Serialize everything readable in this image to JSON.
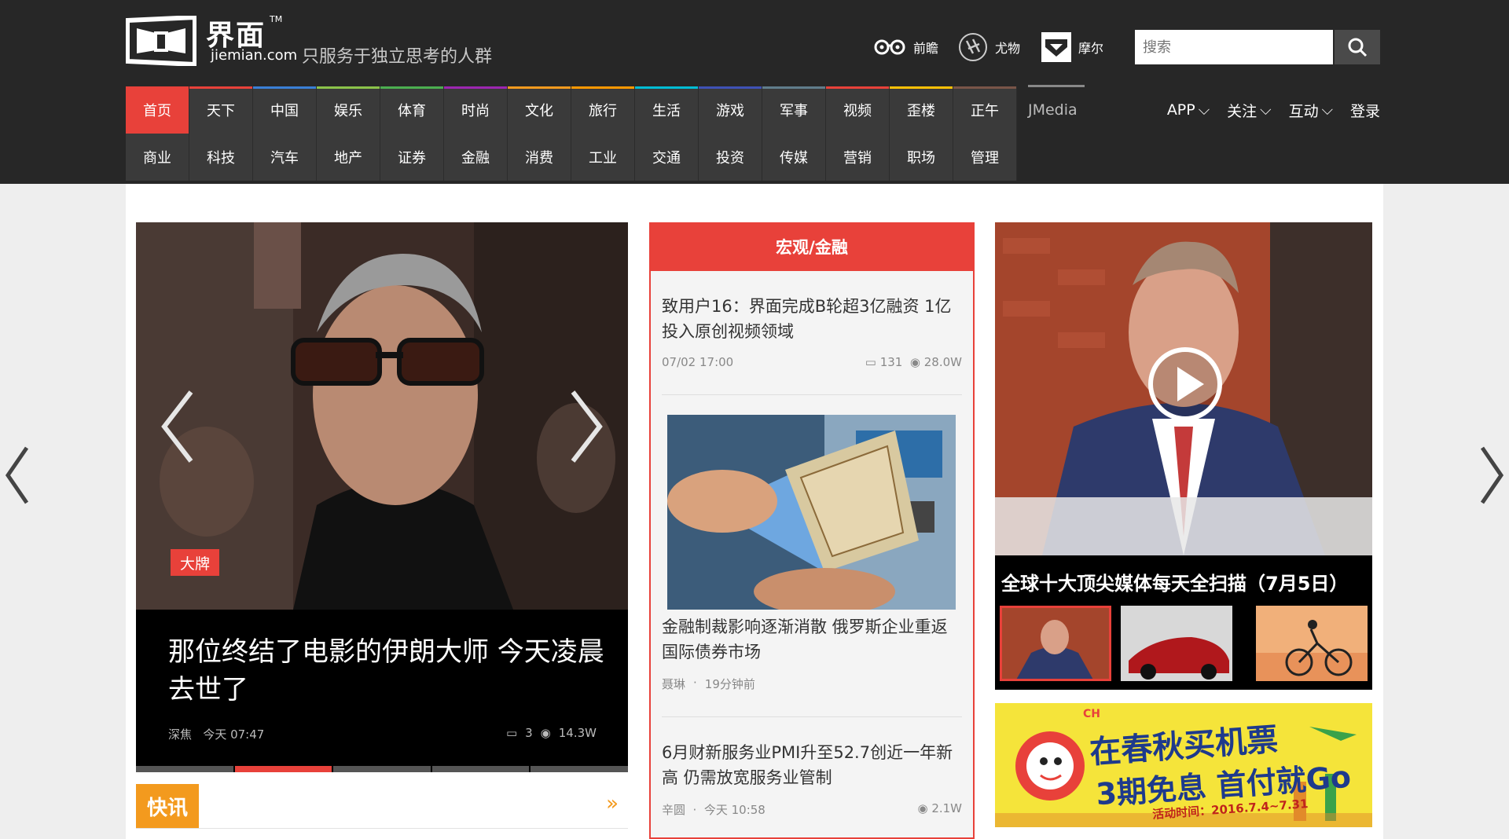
{
  "header": {
    "logo_cn": "界面",
    "logo_tm": "TM",
    "logo_en": "jiemian.com",
    "slogan": "只服务于独立思考的人群",
    "brands": [
      {
        "label": "前瞻",
        "icon": "glasses-icon"
      },
      {
        "label": "尤物",
        "icon": "youwu-seal-icon"
      },
      {
        "label": "摩尔",
        "icon": "moer-icon"
      }
    ],
    "search_placeholder": "搜索"
  },
  "nav": {
    "row1": [
      {
        "label": "首页",
        "color": "#e8413a"
      },
      {
        "label": "天下",
        "color": "#e8413a"
      },
      {
        "label": "中国",
        "color": "#3a7fd5"
      },
      {
        "label": "娱乐",
        "color": "#8bc34a"
      },
      {
        "label": "体育",
        "color": "#4caf50"
      },
      {
        "label": "时尚",
        "color": "#9c27b0"
      },
      {
        "label": "文化",
        "color": "#f39a1e"
      },
      {
        "label": "旅行",
        "color": "#ff9800"
      },
      {
        "label": "生活",
        "color": "#00bcd4"
      },
      {
        "label": "游戏",
        "color": "#3f51b5"
      },
      {
        "label": "军事",
        "color": "#607d8b"
      },
      {
        "label": "视频",
        "color": "#e8413a"
      },
      {
        "label": "歪楼",
        "color": "#ffc107"
      },
      {
        "label": "正午",
        "color": "#795548"
      }
    ],
    "jmedia": "JMedia",
    "row2": [
      "商业",
      "科技",
      "汽车",
      "地产",
      "证券",
      "金融",
      "消费",
      "工业",
      "交通",
      "投资",
      "传媒",
      "营销",
      "职场",
      "管理"
    ],
    "right": {
      "app": "APP",
      "follow": "关注",
      "interact": "互动",
      "login": "登录"
    }
  },
  "hero": {
    "tag": "大牌",
    "title": "那位终结了电影的伊朗大师 今天凌晨去世了",
    "author": "深焦",
    "time": "今天 07:47",
    "comments": "3",
    "views": "14.3W"
  },
  "kuaixun": {
    "label": "快讯",
    "more": "»"
  },
  "middle": {
    "heading": "宏观/金融",
    "articles": [
      {
        "title": "致用户16：界面完成B轮超3亿融资 1亿投入原创视频领域",
        "time": "07/02 17:00",
        "comments": "131",
        "views": "28.0W"
      },
      {
        "title": "金融制裁影响逐渐消散 俄罗斯企业重返国际债券市场",
        "author": "聂琳",
        "time": "19分钟前"
      },
      {
        "title": "6月财新服务业PMI升至52.7创近一年新高 仍需放宽服务业管制",
        "author": "辛圆",
        "time": "今天 10:58",
        "views": "2.1W"
      }
    ]
  },
  "video": {
    "title": "全球十大顶尖媒体每天全扫描（7月5日）"
  },
  "ad": {
    "text_main": "在春秋买机票",
    "text_sub": "3期免息 首付就Go",
    "date": "活动时间：2016.7.4~7.31",
    "brand": "CH"
  },
  "colors": {
    "accent": "#e8413a",
    "header_bg": "#272727",
    "orange": "#f39a1e"
  }
}
